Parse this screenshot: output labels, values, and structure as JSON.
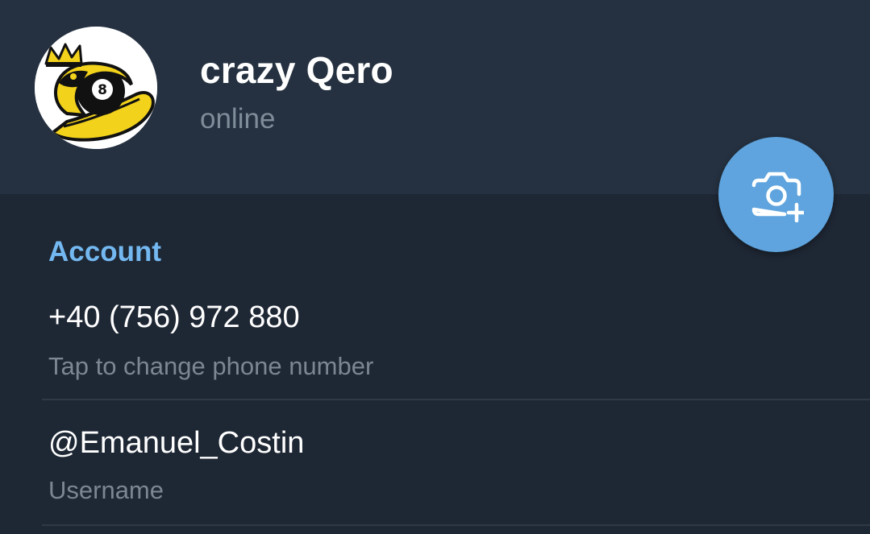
{
  "profile": {
    "name": "crazy Qero",
    "status": "online",
    "avatar_icon": "snake-eight-ball-avatar"
  },
  "actions": {
    "set_photo_icon": "camera-add-icon",
    "accent_color": "#5fa4de"
  },
  "account": {
    "section_title": "Account",
    "phone": {
      "value": "+40 (756) 972 880",
      "hint": "Tap to change phone number"
    },
    "username": {
      "value": "@Emanuel_Costin",
      "hint": "Username"
    }
  },
  "colors": {
    "background": "#1e2734",
    "header_background": "#253140",
    "section_title": "#73b8f0",
    "secondary_text": "#7c8793"
  }
}
